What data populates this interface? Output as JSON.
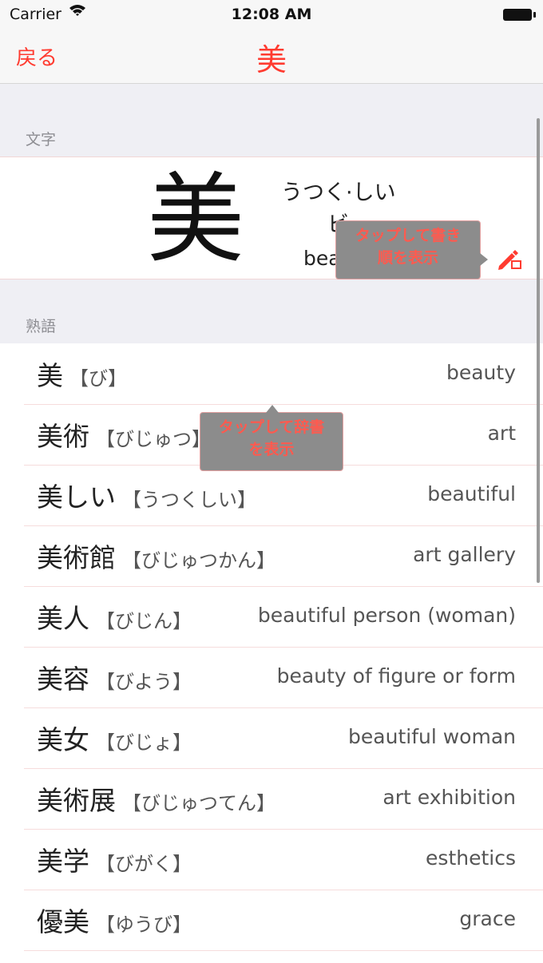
{
  "status_bar": {
    "carrier": "Carrier",
    "time": "12:08 AM"
  },
  "nav": {
    "back_label": "戻る",
    "title": "美"
  },
  "character_section": {
    "header": "文字",
    "kanji": "美",
    "kun_reading": "うつく·しい",
    "on_reading": "ビ",
    "meaning": "beauty"
  },
  "compounds_section": {
    "header": "熟語",
    "rows": [
      {
        "word": "美",
        "reading": "【び】",
        "meaning": "beauty"
      },
      {
        "word": "美術",
        "reading": "【びじゅつ】",
        "meaning": "art"
      },
      {
        "word": "美しい",
        "reading": "【うつくしい】",
        "meaning": "beautiful"
      },
      {
        "word": "美術館",
        "reading": "【びじゅつかん】",
        "meaning": "art gallery"
      },
      {
        "word": "美人",
        "reading": "【びじん】",
        "meaning": "beautiful person (woman)"
      },
      {
        "word": "美容",
        "reading": "【びよう】",
        "meaning": "beauty of figure or form"
      },
      {
        "word": "美女",
        "reading": "【びじょ】",
        "meaning": "beautiful woman"
      },
      {
        "word": "美術展",
        "reading": "【びじゅつてん】",
        "meaning": "art exhibition"
      },
      {
        "word": "美学",
        "reading": "【びがく】",
        "meaning": "esthetics"
      },
      {
        "word": "優美",
        "reading": "【ゆうび】",
        "meaning": "grace"
      }
    ]
  },
  "tooltips": {
    "stroke_order": {
      "line1": "タップして書き",
      "line2": "順を表示"
    },
    "dictionary": {
      "line1": "タップして辞書",
      "line2": "を表示"
    }
  },
  "icons": {
    "stroke_order": "pencil-icon",
    "wifi": "wifi-icon",
    "battery": "battery-icon"
  },
  "colors": {
    "accent": "#ff3b30",
    "tooltip_bg": "#8c8c8c",
    "tooltip_text": "#ff5a4f"
  }
}
